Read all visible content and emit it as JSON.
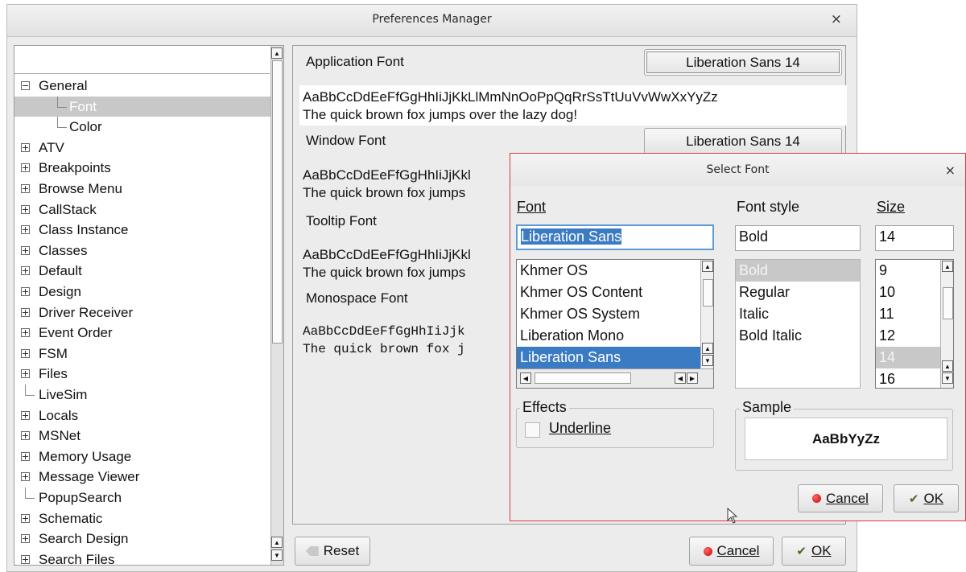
{
  "main_window": {
    "title": "Preferences Manager",
    "close": "×"
  },
  "tree": {
    "items": [
      {
        "label": "General",
        "kind": "expanded"
      },
      {
        "label": "Font",
        "kind": "child",
        "selected": true
      },
      {
        "label": "Color",
        "kind": "child"
      },
      {
        "label": "ATV",
        "kind": "collapsed"
      },
      {
        "label": "Breakpoints",
        "kind": "collapsed"
      },
      {
        "label": "Browse Menu",
        "kind": "collapsed"
      },
      {
        "label": "CallStack",
        "kind": "collapsed"
      },
      {
        "label": "Class Instance",
        "kind": "collapsed"
      },
      {
        "label": "Classes",
        "kind": "collapsed"
      },
      {
        "label": "Default",
        "kind": "collapsed"
      },
      {
        "label": "Design",
        "kind": "collapsed"
      },
      {
        "label": "Driver Receiver",
        "kind": "collapsed"
      },
      {
        "label": "Event Order",
        "kind": "collapsed"
      },
      {
        "label": "FSM",
        "kind": "collapsed"
      },
      {
        "label": "Files",
        "kind": "collapsed"
      },
      {
        "label": "LiveSim",
        "kind": "leaf"
      },
      {
        "label": "Locals",
        "kind": "collapsed"
      },
      {
        "label": "MSNet",
        "kind": "collapsed"
      },
      {
        "label": "Memory Usage",
        "kind": "collapsed"
      },
      {
        "label": "Message Viewer",
        "kind": "collapsed"
      },
      {
        "label": "PopupSearch",
        "kind": "leaf"
      },
      {
        "label": "Schematic",
        "kind": "collapsed"
      },
      {
        "label": "Search Design",
        "kind": "collapsed"
      },
      {
        "label": "Search Files",
        "kind": "collapsed"
      }
    ]
  },
  "fonts": {
    "application": {
      "label": "Application Font",
      "button": "Liberation Sans 14",
      "sample_line1": "AaBbCcDdEeFfGgHhIiJjKkLlMmNnOoPpQqRrSsTtUuVvWwXxYyZz",
      "sample_line2": "The quick brown fox jumps over the lazy dog!"
    },
    "window": {
      "label": "Window Font",
      "button": "Liberation Sans 14",
      "sample_line1": "AaBbCcDdEeFfGgHhIiJjKkl",
      "sample_line2": "The quick brown fox jumps"
    },
    "tooltip": {
      "label": "Tooltip Font",
      "sample_line1": "AaBbCcDdEeFfGgHhIiJjKkl",
      "sample_line2": "The quick brown fox jumps"
    },
    "monospace": {
      "label": "Monospace Font",
      "sample_line1": "AaBbCcDdEeFfGgHhIiJjk",
      "sample_line2": "The quick brown fox j"
    }
  },
  "footer": {
    "reset": "Reset",
    "cancel": "Cancel",
    "ok": "OK"
  },
  "select_font": {
    "title": "Select Font",
    "close": "×",
    "font_heading": "Font",
    "font_value": "Liberation Sans",
    "font_list": [
      "Khmer OS",
      "Khmer OS Content",
      "Khmer OS System",
      "Liberation Mono",
      "Liberation Sans"
    ],
    "style_heading": "Font style",
    "style_value": "Bold",
    "style_list": [
      "Bold",
      "Regular",
      "Italic",
      "Bold Italic"
    ],
    "size_heading": "Size",
    "size_value": "14",
    "size_list": [
      "9",
      "10",
      "11",
      "12",
      "14",
      "16"
    ],
    "effects_title": "Effects",
    "underline": "Underline",
    "sample_title": "Sample",
    "sample_text": "AaBbYyZz",
    "cancel": "Cancel",
    "ok": "OK"
  },
  "colors": {
    "selection_blue": "#3b7bc4",
    "dialog_border_red": "#d83a3a"
  }
}
